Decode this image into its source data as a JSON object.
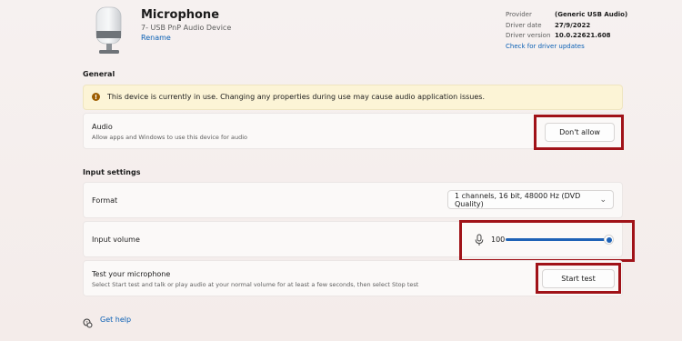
{
  "device": {
    "name": "Microphone",
    "subtitle": "7- USB PnP Audio Device",
    "rename_label": "Rename"
  },
  "properties": {
    "provider_key": "Provider",
    "provider_val": "(Generic USB Audio)",
    "date_key": "Driver date",
    "date_val": "27/9/2022",
    "version_key": "Driver version",
    "version_val": "10.0.22621.608",
    "update_link": "Check for driver updates"
  },
  "general": {
    "heading": "General",
    "warning_icon": "info-icon",
    "warning_text": "This device is currently in use. Changing any properties during use may cause audio application issues.",
    "audio_title": "Audio",
    "audio_desc": "Allow apps and Windows to use this device for audio",
    "audio_button": "Don't allow"
  },
  "input": {
    "heading": "Input settings",
    "format_label": "Format",
    "format_value": "1 channels, 16 bit, 48000 Hz (DVD Quality)",
    "volume_label": "Input volume",
    "volume_value": "100",
    "volume_level": 1.0,
    "test_title": "Test your microphone",
    "test_desc": "Select Start test and talk or play audio at your normal volume for at least a few seconds, then select Stop test",
    "test_button": "Start test"
  },
  "help": {
    "label": "Get help"
  },
  "colors": {
    "accent": "#1e62b6",
    "link": "#0a5fb4",
    "highlight": "#a01218",
    "warning_bg": "#fcf4d6"
  }
}
